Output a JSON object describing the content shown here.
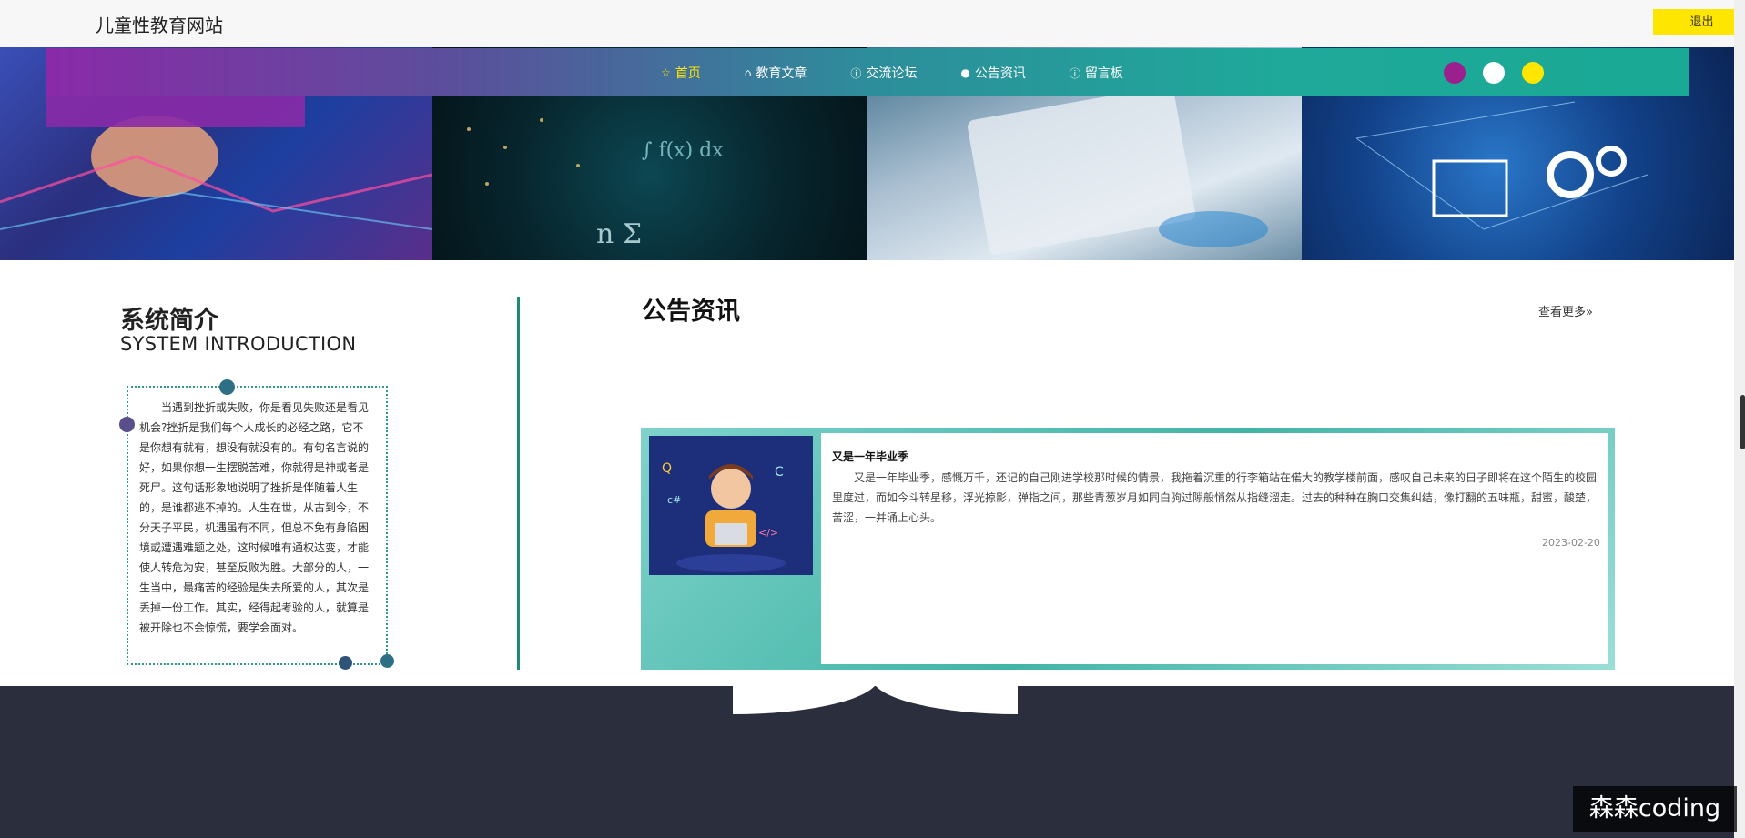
{
  "header": {
    "site_title": "儿童性教育网站",
    "logout_label": "退出"
  },
  "nav": {
    "items": [
      {
        "label": "首页",
        "icon": "star-icon",
        "active": true
      },
      {
        "label": "教育文章",
        "icon": "home-icon",
        "active": false
      },
      {
        "label": "交流论坛",
        "icon": "info-icon",
        "active": false
      },
      {
        "label": "公告资讯",
        "icon": "circle-icon",
        "active": false
      },
      {
        "label": "留言板",
        "icon": "info-icon",
        "active": false
      }
    ],
    "theme_colors": [
      "#9b1f8c",
      "#ffffff",
      "#ffe600"
    ]
  },
  "intro": {
    "title_cn": "系统简介",
    "title_en": "SYSTEM INTRODUCTION",
    "text": "当遇到挫折或失败，你是看见失败还是看见机会?挫折是我们每个人成长的必经之路，它不是你想有就有，想没有就没有的。有句名言说的好，如果你想一生摆脱苦难，你就得是神或者是死尸。这句话形象地说明了挫折是伴随着人生的，是谁都逃不掉的。人生在世，从古到今，不分天子平民，机遇虽有不同，但总不免有身陷困境或遭遇难题之处，这时候唯有通权达变，才能使人转危为安，甚至反败为胜。大部分的人，一生当中，最痛苦的经验是失去所爱的人，其次是丢掉一份工作。其实，经得起考验的人，就算是被开除也不会惊慌，要学会面对。"
  },
  "notices": {
    "title": "公告资讯",
    "more_label": "查看更多»",
    "items": [
      {
        "heading": "又是一年毕业季",
        "text": "又是一年毕业季，感慨万千，还记的自己刚进学校那时候的情景，我拖着沉重的行李箱站在偌大的教学楼前面，感叹自己未来的日子即将在这个陌生的校园里度过，而如今斗转星移，浮光掠影，弹指之间，那些青葱岁月如同白驹过隙般悄然从指缝溜走。过去的种种在胸口交集纠结，像打翻的五味瓶，甜蜜，酸楚，苦涩，一并涌上心头。",
        "date": "2023-02-20"
      }
    ]
  },
  "watermark": "森森coding"
}
